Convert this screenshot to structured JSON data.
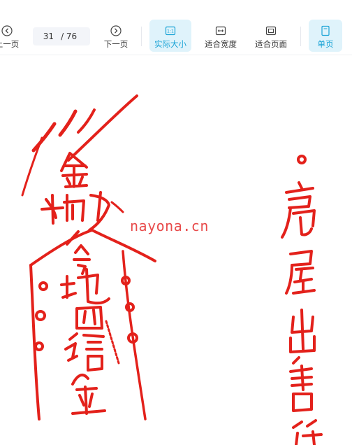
{
  "toolbar": {
    "prev_label": "上一页",
    "page_current": "31",
    "page_total": "/ 76",
    "next_label": "下一页",
    "actual_size_label": "实际大小",
    "fit_width_label": "适合宽度",
    "fit_page_label": "适合页面",
    "single_page_label": "单页",
    "active_button": "actual_size",
    "accent_color": "#1aa3d6",
    "active_bg": "#dff3fb"
  },
  "document": {
    "watermark": "nayona.cn",
    "seal_color": "#e3211b",
    "talisman_chars": [
      "金",
      "勅",
      "令",
      "地",
      "四",
      "僖"
    ],
    "right_caption": [
      "房",
      "屋",
      "出",
      "售",
      "符"
    ]
  },
  "icons": {
    "prev": "chevron-left-circle-icon",
    "next": "chevron-right-circle-icon",
    "actual_size": "actual-size-icon",
    "fit_width": "fit-width-icon",
    "fit_page": "fit-page-icon",
    "single_page": "single-page-icon"
  }
}
